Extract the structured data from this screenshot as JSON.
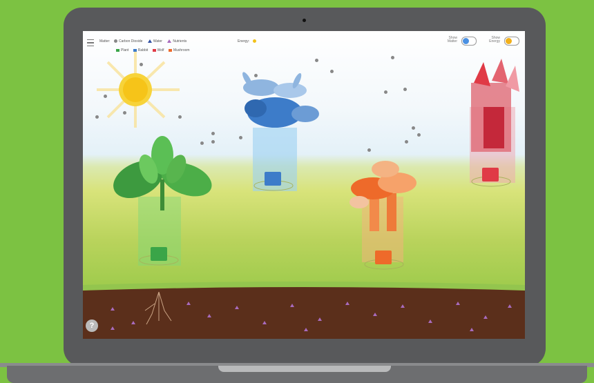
{
  "legend": {
    "matter_label": "Matter:",
    "items_row1": [
      {
        "label": "Carbon Dioxide",
        "shape": "dot",
        "color": "#888888"
      },
      {
        "label": "Water",
        "shape": "tri",
        "color": "#2f4fa2"
      },
      {
        "label": "Nutrients",
        "shape": "tri",
        "color": "#a86bbd"
      }
    ],
    "items_row2": [
      {
        "label": "Plant",
        "shape": "sq",
        "color": "#3aa548"
      },
      {
        "label": "Rabbit",
        "shape": "sq",
        "color": "#3d7cc9"
      },
      {
        "label": "Wolf",
        "shape": "sq",
        "color": "#e03a46"
      },
      {
        "label": "Mushroom",
        "shape": "sq",
        "color": "#ee6a2a"
      }
    ],
    "energy_label": "Energy:",
    "energy_color": "#f2c21b"
  },
  "toggles": {
    "matter": {
      "label_line1": "Show",
      "label_line2": "Matter",
      "on": true,
      "color": "#4a90e2"
    },
    "energy": {
      "label_line1": "Show",
      "label_line2": "Energy",
      "on": true,
      "color": "#f2b01b"
    }
  },
  "help_label": "?",
  "organisms": [
    {
      "name": "plant",
      "icon": "plant-icon",
      "color": "#3aa548"
    },
    {
      "name": "rabbit",
      "icon": "rabbit-icon",
      "color": "#3d7cc9"
    },
    {
      "name": "mushroom",
      "icon": "mushroom-icon",
      "color": "#ee6a2a"
    },
    {
      "name": "wolf",
      "icon": "wolf-icon",
      "color": "#e03a46"
    }
  ]
}
